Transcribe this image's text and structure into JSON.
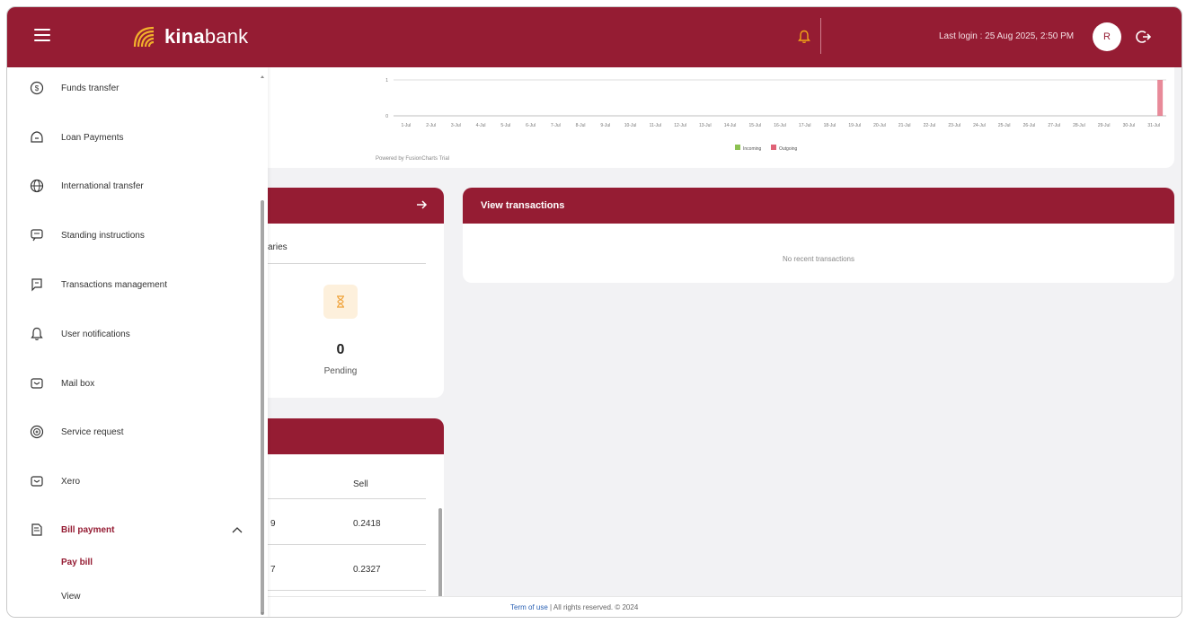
{
  "header": {
    "brand_bold": "kina",
    "brand_light": "bank",
    "last_login": "Last login : 25 Aug 2025, 2:50 PM",
    "avatar_initial": "R",
    "brand_color": "#951c33"
  },
  "sidebar": {
    "items": [
      {
        "label": "Funds transfer",
        "icon": "funds-transfer-icon"
      },
      {
        "label": "Loan Payments",
        "icon": "loan-payments-icon"
      },
      {
        "label": "International transfer",
        "icon": "globe-icon"
      },
      {
        "label": "Standing instructions",
        "icon": "standing-instructions-icon"
      },
      {
        "label": "Transactions management",
        "icon": "transactions-management-icon"
      },
      {
        "label": "User notifications",
        "icon": "bell-icon"
      },
      {
        "label": "Mail box",
        "icon": "mailbox-icon"
      },
      {
        "label": "Service request",
        "icon": "service-request-icon"
      },
      {
        "label": "Xero",
        "icon": "xero-icon"
      },
      {
        "label": "Bill payment",
        "icon": "bill-payment-icon"
      }
    ],
    "sub_items": [
      {
        "label": "Pay bill"
      },
      {
        "label": "View"
      }
    ]
  },
  "chart": {
    "credit": "Powered by FusionCharts Trial",
    "chart_data": {
      "type": "bar",
      "categories": [
        "1-Jul",
        "2-Jul",
        "3-Jul",
        "4-Jul",
        "5-Jul",
        "6-Jul",
        "7-Jul",
        "8-Jul",
        "9-Jul",
        "10-Jul",
        "11-Jul",
        "12-Jul",
        "13-Jul",
        "14-Jul",
        "15-Jul",
        "16-Jul",
        "17-Jul",
        "18-Jul",
        "19-Jul",
        "20-Jul",
        "21-Jul",
        "22-Jul",
        "23-Jul",
        "24-Jul",
        "25-Jul",
        "26-Jul",
        "27-Jul",
        "28-Jul",
        "29-Jul",
        "30-Jul",
        "31-Jul"
      ],
      "y_ticks": [
        "0",
        "1"
      ],
      "series": [
        {
          "name": "Incoming",
          "color": "#8cc152",
          "values": [
            0,
            0,
            0,
            0,
            0,
            0,
            0,
            0,
            0,
            0,
            0,
            0,
            0,
            0,
            0,
            0,
            0,
            0,
            0,
            0,
            0,
            0,
            0,
            0,
            0,
            0,
            0,
            0,
            0,
            0,
            0
          ]
        },
        {
          "name": "Outgoing",
          "color": "#e06377",
          "values": [
            0,
            0,
            0,
            0,
            0,
            0,
            0,
            0,
            0,
            0,
            0,
            0,
            0,
            0,
            0,
            0,
            0,
            0,
            0,
            0,
            0,
            0,
            0,
            0,
            0,
            0,
            0,
            0,
            0,
            0,
            1
          ]
        }
      ],
      "legend_placement": "bottom"
    }
  },
  "summary": {
    "tab_partial": "aries",
    "pending_count": "0",
    "pending_label": "Pending"
  },
  "transactions": {
    "title": "View transactions",
    "empty_text": "No recent transactions"
  },
  "rates": {
    "sell_header": "Sell",
    "rows": [
      {
        "buy_partial": "9",
        "sell": "0.2418"
      },
      {
        "buy_partial": "7",
        "sell": "0.2327"
      }
    ]
  },
  "footer": {
    "link": "Term of use",
    "text": "| All rights reserved. © 2024"
  }
}
